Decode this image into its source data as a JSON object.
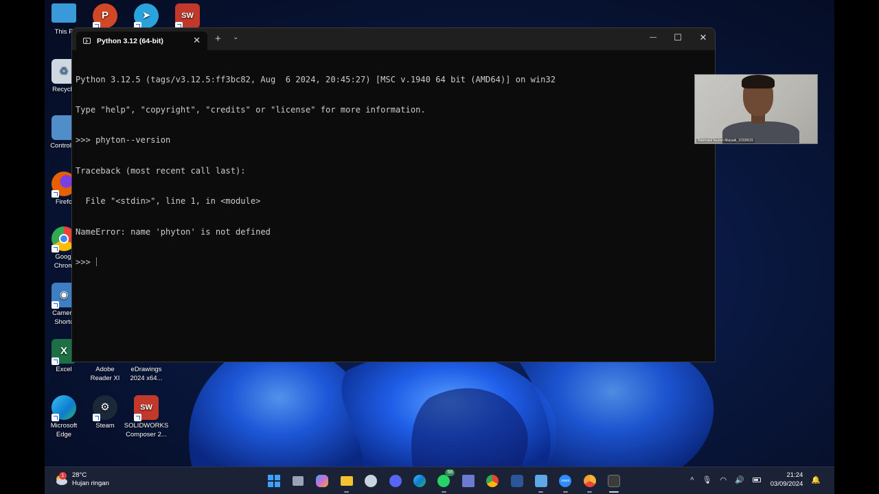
{
  "desktop_icons": [
    {
      "label": "This P",
      "color": "#3a9ad9",
      "glyph": ""
    },
    {
      "label": "",
      "color": "#d24726",
      "glyph": "P"
    },
    {
      "label": "",
      "color": "#2aa3dd",
      "glyph": "➤"
    },
    {
      "label": "",
      "color": "#c0392b",
      "glyph": "SW"
    },
    {
      "label": "Recycle",
      "color": "#7aa7c7",
      "glyph": "♻"
    },
    {
      "label": "Control P",
      "color": "#4f8ec9",
      "glyph": ""
    },
    {
      "label": "Firefo",
      "color": "#e66000",
      "glyph": ""
    },
    {
      "label": "Googl\nChrom",
      "color": "#4285f4",
      "glyph": ""
    },
    {
      "label": "Camera\nShortc",
      "color": "#3d7fc2",
      "glyph": "◉"
    },
    {
      "label": "Excel",
      "color": "#1d7044",
      "glyph": "X"
    },
    {
      "label": "Adobe\nReader XI",
      "color": "transparent",
      "glyph": ""
    },
    {
      "label": "eDrawings\n2024 x64...",
      "color": "transparent",
      "glyph": ""
    },
    {
      "label": "Microsoft\nEdge",
      "color": "#0f7bd0",
      "glyph": "e"
    },
    {
      "label": "Steam",
      "color": "#1b2838",
      "glyph": "⚙"
    },
    {
      "label": "SOLIDWORKS\nComposer 2...",
      "color": "#c0392b",
      "glyph": "SW"
    }
  ],
  "terminal": {
    "tab_title": "Python 3.12 (64-bit)",
    "tab_close": "✕",
    "new_tab": "+",
    "dropdown": "⌄",
    "minimize": "—",
    "maximize": "☐",
    "close": "✕",
    "lines": [
      "Python 3.12.5 (tags/v3.12.5:ff3bc82, Aug  6 2024, 20:45:27) [MSC v.1940 64 bit (AMD64)] on win32",
      "Type \"help\", \"copyright\", \"credits\" or \"license\" for more information.",
      ">>> phyton--version",
      "Traceback (most recent call last):",
      "  File \"<stdin>\", line 1, in <module>",
      "NameError: name 'phyton' is not defined"
    ],
    "prompt": ">>> "
  },
  "webcam": {
    "label": "Rahmatul fauzan Mulyadi_22338115"
  },
  "taskbar": {
    "weather_badge": "1",
    "temperature": "28°C",
    "weather_desc": "Hujan ringan",
    "apps": [
      {
        "name": "start-icon",
        "color": "#3ea0ff"
      },
      {
        "name": "task-view-icon",
        "color": "#9aa3b5"
      },
      {
        "name": "copilot-icon",
        "color": "#c86dd7"
      },
      {
        "name": "file-explorer-icon",
        "color": "#f2c230"
      },
      {
        "name": "steam-icon",
        "color": "#c7d5e0"
      },
      {
        "name": "discord-icon",
        "color": "#5865f2"
      },
      {
        "name": "edge-icon",
        "color": "#1fa3e8"
      },
      {
        "name": "whatsapp-icon",
        "color": "#25d366"
      },
      {
        "name": "dev-cpp-icon",
        "color": "#6a7bd1"
      },
      {
        "name": "chrome-icon",
        "color": "#e8453c"
      },
      {
        "name": "word-icon",
        "color": "#2b579a"
      },
      {
        "name": "network-map-icon",
        "color": "#5fa8e8"
      },
      {
        "name": "zoom-icon",
        "color": "#2d8cff"
      },
      {
        "name": "chrome-canary-icon",
        "color": "#f2b632"
      },
      {
        "name": "terminal-icon",
        "color": "#3b3b3b"
      }
    ],
    "whatsapp_count": "58",
    "zoom_text": "zoom",
    "tray_chevron": "^",
    "time": "21:24",
    "date": "03/09/2024"
  }
}
